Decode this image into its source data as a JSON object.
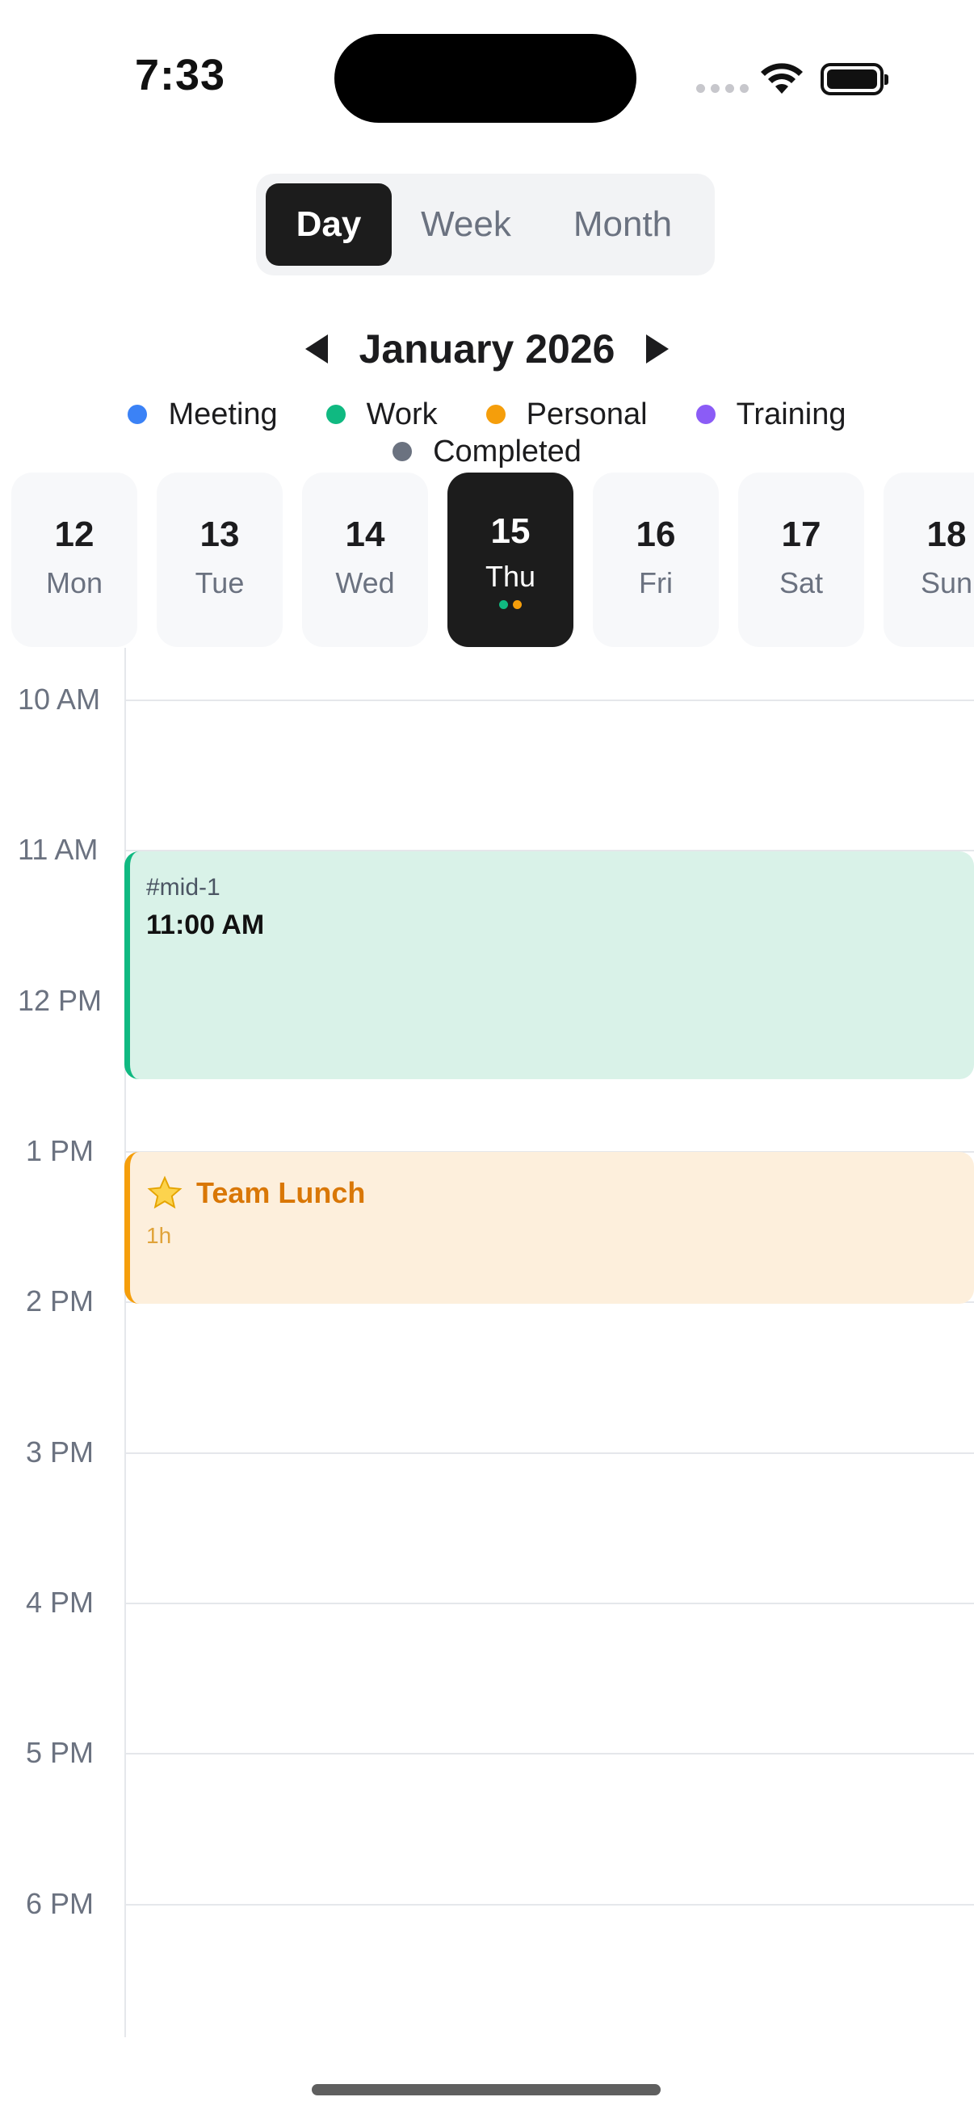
{
  "status_bar": {
    "time": "7:33"
  },
  "view_switcher": {
    "day": "Day",
    "week": "Week",
    "month": "Month",
    "selected": "Day"
  },
  "calendar": {
    "month_title": "January 2026"
  },
  "legend": [
    {
      "label": "Meeting",
      "color": "#3b82f6"
    },
    {
      "label": "Work",
      "color": "#10b981"
    },
    {
      "label": "Personal",
      "color": "#f59e0b"
    },
    {
      "label": "Training",
      "color": "#8b5cf6"
    },
    {
      "label": "Completed",
      "color": "#6b7280"
    }
  ],
  "days": [
    {
      "num": "12",
      "weekday": "Mon"
    },
    {
      "num": "13",
      "weekday": "Tue"
    },
    {
      "num": "14",
      "weekday": "Wed"
    },
    {
      "num": "15",
      "weekday": "Thu",
      "selected": true
    },
    {
      "num": "16",
      "weekday": "Fri"
    },
    {
      "num": "17",
      "weekday": "Sat"
    },
    {
      "num": "18",
      "weekday": "Sun"
    }
  ],
  "hours": [
    "10 AM",
    "11 AM",
    "12 PM",
    "1 PM",
    "2 PM",
    "3 PM",
    "4 PM",
    "5 PM",
    "6 PM"
  ],
  "events": [
    {
      "id": "#mid-1",
      "time": "11:00 AM",
      "category": "Work"
    },
    {
      "title": "Team Lunch",
      "duration": "1h",
      "icon": "star-icon",
      "category": "Personal"
    }
  ]
}
